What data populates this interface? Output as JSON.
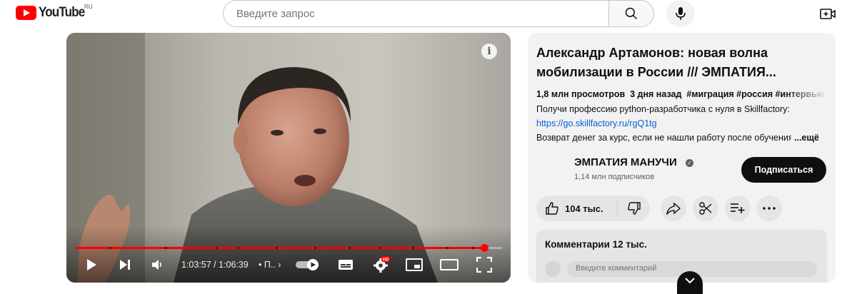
{
  "header": {
    "logo_text": "YouTube",
    "region": "RU",
    "search_placeholder": "Введите запрос",
    "icons": [
      "youtube-logo-icon",
      "search-icon",
      "microphone-icon",
      "create-video-icon"
    ]
  },
  "player": {
    "time_current": "1:03:57",
    "time_total": "1:06:39",
    "time_display": "1:03:57 / 1:06:39",
    "chapter": "• П..",
    "hd_badge": "HD",
    "progress": 0.959,
    "progress_color": "#ff0000",
    "chapter_breaks": [
      0.08,
      0.21,
      0.33,
      0.38,
      0.47,
      0.56,
      0.64,
      0.71,
      0.79,
      0.87,
      0.93
    ],
    "icons": [
      "info-icon",
      "play-icon",
      "next-icon",
      "volume-icon",
      "autoplay-toggle-icon",
      "subtitles-icon",
      "settings-icon",
      "miniplayer-icon",
      "theater-mode-icon",
      "fullscreen-icon"
    ]
  },
  "video": {
    "title": "Александр Артамонов: новая волна мобилизации в России /// ЭМПАТИЯ...",
    "views": "1,8 млн просмотров",
    "age": "3 дня назад",
    "tags": "#миграция #россия #интервью",
    "description": [
      "Получи профессию python-разработчика с нуля в Skillfactory:",
      "https://go.skillfactory.ru/rgQ1tg",
      "Возврат денег за курс, если не нашли работу после обучения"
    ],
    "more_label": "...ещё"
  },
  "channel": {
    "name": "ЭМПАТИЯ МАНУЧИ",
    "subscribers": "1,14 млн подписчиков",
    "subscribe_label": "Подписаться"
  },
  "actions": {
    "likes": "104 тыс.",
    "icons": [
      "thumbs-up-icon",
      "thumbs-down-icon",
      "share-icon",
      "clip-icon",
      "save-playlist-icon",
      "more-icon"
    ]
  },
  "comments": {
    "title": "Комментарии 12 тыс.",
    "placeholder": "Введите комментарий"
  },
  "colors": {
    "brand_red": "#ff0000",
    "panel_bg": "#f2f2f2",
    "link": "#065fd4",
    "subscribe_bg": "#0f0f0f"
  }
}
